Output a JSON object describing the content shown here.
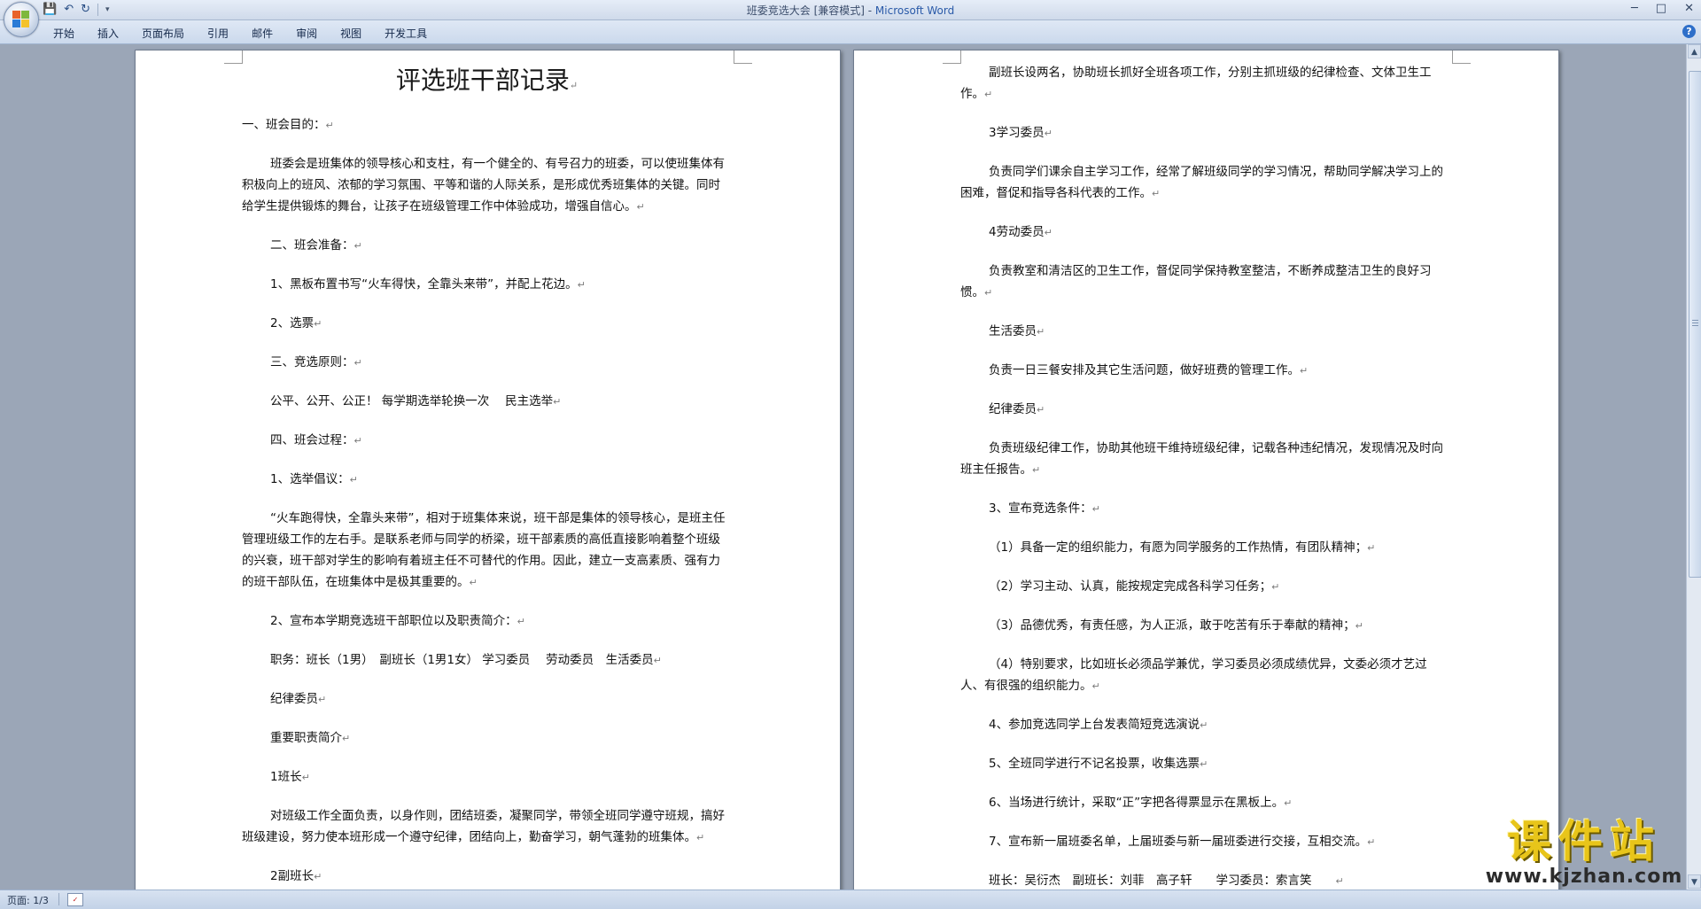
{
  "window": {
    "title_doc": "班委竞选大会 [兼容模式] - ",
    "title_app": "Microsoft Word",
    "minimize": "─",
    "maximize": "□",
    "close": "✕"
  },
  "qat": {
    "save": "💾",
    "undo": "↶",
    "redo": "↻",
    "more": "▾"
  },
  "ribbon": {
    "tabs": [
      "开始",
      "插入",
      "页面布局",
      "引用",
      "邮件",
      "审阅",
      "视图",
      "开发工具"
    ],
    "help": "?"
  },
  "doc": {
    "title": "评选班干部记录",
    "left_paras": [
      {
        "text": "一、班会目的：",
        "indent": false
      },
      {
        "text": "班委会是班集体的领导核心和支柱，有一个健全的、有号召力的班委，可以使班集体有积极向上的班风、浓郁的学习氛围、平等和谐的人际关系，是形成优秀班集体的关键。同时给学生提供锻炼的舞台，让孩子在班级管理工作中体验成功，增强自信心。",
        "indent": true
      },
      {
        "text": "二、班会准备：",
        "indent": true
      },
      {
        "text": "1、黑板布置书写“火车得快，全靠头来带”，并配上花边。",
        "indent": true
      },
      {
        "text": "2、选票",
        "indent": true
      },
      {
        "text": "三、竞选原则：",
        "indent": true
      },
      {
        "text": "公平、公开、公正！ 每学期选举轮换一次　 民主选举",
        "indent": true
      },
      {
        "text": "四、班会过程：",
        "indent": true
      },
      {
        "text": "1、选举倡议：",
        "indent": true
      },
      {
        "text": "“火车跑得快，全靠头来带”，相对于班集体来说，班干部是集体的领导核心，是班主任管理班级工作的左右手。是联系老师与同学的桥梁，班干部素质的高低直接影响着整个班级的兴衰，班干部对学生的影响有着班主任不可替代的作用。因此，建立一支高素质、强有力的班干部队伍，在班集体中是极其重要的。",
        "indent": true
      },
      {
        "text": "2、宣布本学期竞选班干部职位以及职责简介：",
        "indent": true
      },
      {
        "text": "职务：班长（1男）　副班长（1男1女） 学习委员　 劳动委员　生活委员",
        "indent": true
      },
      {
        "text": "纪律委员",
        "indent": true
      },
      {
        "text": "重要职责简介",
        "indent": true
      },
      {
        "text": "1班长",
        "indent": true
      },
      {
        "text": "对班级工作全面负责，以身作则，团结班委，凝聚同学，带领全班同学遵守班规，搞好班级建设，努力使本班形成一个遵守纪律，团结向上，勤奋学习，朝气蓬勃的班集体。",
        "indent": true
      },
      {
        "text": "2副班长",
        "indent": true
      }
    ],
    "right_paras": [
      {
        "text": "副班长设两名，协助班长抓好全班各项工作，分别主抓班级的纪律检查、文体卫生工作。",
        "indent": true
      },
      {
        "text": "3学习委员",
        "indent": true
      },
      {
        "text": "负责同学们课余自主学习工作，经常了解班级同学的学习情况，帮助同学解决学习上的困难，督促和指导各科代表的工作。",
        "indent": true
      },
      {
        "text": "4劳动委员",
        "indent": true
      },
      {
        "text": "负责教室和清洁区的卫生工作，督促同学保持教室整洁，不断养成整洁卫生的良好习惯。",
        "indent": true
      },
      {
        "text": "生活委员",
        "indent": true
      },
      {
        "text": "负责一日三餐安排及其它生活问题，做好班费的管理工作。",
        "indent": true
      },
      {
        "text": "纪律委员",
        "indent": true
      },
      {
        "text": "负责班级纪律工作，协助其他班干维持班级纪律，记载各种违纪情况，发现情况及时向班主任报告。",
        "indent": true
      },
      {
        "text": "3、宣布竞选条件：",
        "indent": true
      },
      {
        "text": "（1）具备一定的组织能力，有愿为同学服务的工作热情，有团队精神；",
        "indent": true
      },
      {
        "text": "（2）学习主动、认真，能按规定完成各科学习任务；",
        "indent": true
      },
      {
        "text": "（3）品德优秀，有责任感，为人正派，敢于吃苦有乐于奉献的精神；",
        "indent": true
      },
      {
        "text": "（4）特别要求，比如班长必须品学兼优，学习委员必须成绩优异，文委必须才艺过人、有很强的组织能力。",
        "indent": true
      },
      {
        "text": "4、参加竞选同学上台发表简短竞选演说",
        "indent": true
      },
      {
        "text": "5、全班同学进行不记名投票，收集选票",
        "indent": true
      },
      {
        "text": "6、当场进行统计，采取“正”字把各得票显示在黑板上。",
        "indent": true
      },
      {
        "text": "7、宣布新一届班委名单，上届班委与新一届班委进行交接，互相交流。",
        "indent": true
      },
      {
        "text": "班长：吴衍杰　副班长：刘菲　高子轩　　学习委员：索言笑　　",
        "indent": true
      }
    ],
    "para_mark": "↵"
  },
  "status": {
    "page": "页面: 1/3",
    "proof_icon": "✓"
  },
  "watermark": {
    "brand": "课件站",
    "url": "www.kjzhan.com"
  },
  "scrollbar": {
    "up": "▲",
    "down": "▼"
  }
}
